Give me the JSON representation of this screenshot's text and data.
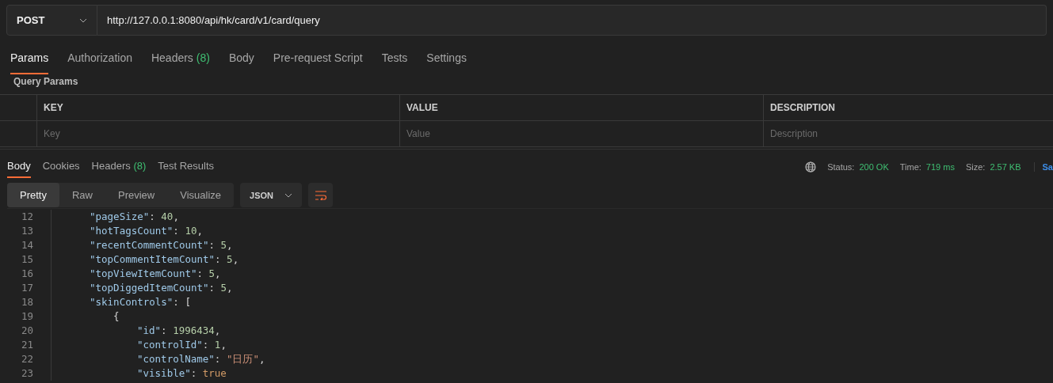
{
  "request": {
    "method": "POST",
    "url": "http://127.0.0.1:8080/api/hk/card/v1/card/query"
  },
  "request_tabs": [
    {
      "label": "Params",
      "selected": true
    },
    {
      "label": "Authorization",
      "selected": false
    },
    {
      "label": "Headers",
      "count": "(8)",
      "selected": false
    },
    {
      "label": "Body",
      "selected": false
    },
    {
      "label": "Pre-request Script",
      "selected": false
    },
    {
      "label": "Tests",
      "selected": false
    },
    {
      "label": "Settings",
      "selected": false
    }
  ],
  "query_params": {
    "title": "Query Params",
    "columns": [
      "KEY",
      "VALUE",
      "DESCRIPTION"
    ],
    "placeholders": [
      "Key",
      "Value",
      "Description"
    ]
  },
  "response_tabs": [
    {
      "label": "Body",
      "selected": true
    },
    {
      "label": "Cookies",
      "selected": false
    },
    {
      "label": "Headers",
      "count": "(8)",
      "selected": false
    },
    {
      "label": "Test Results",
      "selected": false
    }
  ],
  "response_status": {
    "status_label": "Status:",
    "status": "200 OK",
    "time_label": "Time:",
    "time": "719 ms",
    "size_label": "Size:",
    "size": "2.57 KB",
    "save_link": "Sa"
  },
  "view_modes": [
    {
      "label": "Pretty",
      "selected": true
    },
    {
      "label": "Raw",
      "selected": false
    },
    {
      "label": "Preview",
      "selected": false
    },
    {
      "label": "Visualize",
      "selected": false
    }
  ],
  "format": "JSON",
  "code_lines": [
    {
      "number": "12",
      "tokens": [
        {
          "kind": "key",
          "text": "\"pageSize\""
        },
        {
          "kind": "punct",
          "text": ": "
        },
        {
          "kind": "number",
          "text": "40"
        },
        {
          "kind": "punct",
          "text": ","
        }
      ]
    },
    {
      "number": "13",
      "tokens": [
        {
          "kind": "key",
          "text": "\"hotTagsCount\""
        },
        {
          "kind": "punct",
          "text": ": "
        },
        {
          "kind": "number",
          "text": "10"
        },
        {
          "kind": "punct",
          "text": ","
        }
      ]
    },
    {
      "number": "14",
      "tokens": [
        {
          "kind": "key",
          "text": "\"recentCommentCount\""
        },
        {
          "kind": "punct",
          "text": ": "
        },
        {
          "kind": "number",
          "text": "5"
        },
        {
          "kind": "punct",
          "text": ","
        }
      ]
    },
    {
      "number": "15",
      "tokens": [
        {
          "kind": "key",
          "text": "\"topCommentItemCount\""
        },
        {
          "kind": "punct",
          "text": ": "
        },
        {
          "kind": "number",
          "text": "5"
        },
        {
          "kind": "punct",
          "text": ","
        }
      ]
    },
    {
      "number": "16",
      "tokens": [
        {
          "kind": "key",
          "text": "\"topViewItemCount\""
        },
        {
          "kind": "punct",
          "text": ": "
        },
        {
          "kind": "number",
          "text": "5"
        },
        {
          "kind": "punct",
          "text": ","
        }
      ]
    },
    {
      "number": "17",
      "tokens": [
        {
          "kind": "key",
          "text": "\"topDiggedItemCount\""
        },
        {
          "kind": "punct",
          "text": ": "
        },
        {
          "kind": "number",
          "text": "5"
        },
        {
          "kind": "punct",
          "text": ","
        }
      ]
    },
    {
      "number": "18",
      "tokens": [
        {
          "kind": "key",
          "text": "\"skinControls\""
        },
        {
          "kind": "punct",
          "text": ": ["
        }
      ]
    },
    {
      "number": "19",
      "tokens": [
        {
          "kind": "punct",
          "text": "{"
        }
      ]
    },
    {
      "number": "20",
      "tokens": [
        {
          "kind": "key",
          "text": "\"id\""
        },
        {
          "kind": "punct",
          "text": ": "
        },
        {
          "kind": "number",
          "text": "1996434"
        },
        {
          "kind": "punct",
          "text": ","
        }
      ]
    },
    {
      "number": "21",
      "tokens": [
        {
          "kind": "key",
          "text": "\"controlId\""
        },
        {
          "kind": "punct",
          "text": ": "
        },
        {
          "kind": "number",
          "text": "1"
        },
        {
          "kind": "punct",
          "text": ","
        }
      ]
    },
    {
      "number": "22",
      "tokens": [
        {
          "kind": "key",
          "text": "\"controlName\""
        },
        {
          "kind": "punct",
          "text": ": "
        },
        {
          "kind": "string",
          "text": "\"日历\""
        },
        {
          "kind": "punct",
          "text": ","
        }
      ]
    },
    {
      "number": "23",
      "tokens": [
        {
          "kind": "key",
          "text": "\"visible\""
        },
        {
          "kind": "punct",
          "text": ": "
        },
        {
          "kind": "bool",
          "text": "true"
        }
      ]
    }
  ]
}
